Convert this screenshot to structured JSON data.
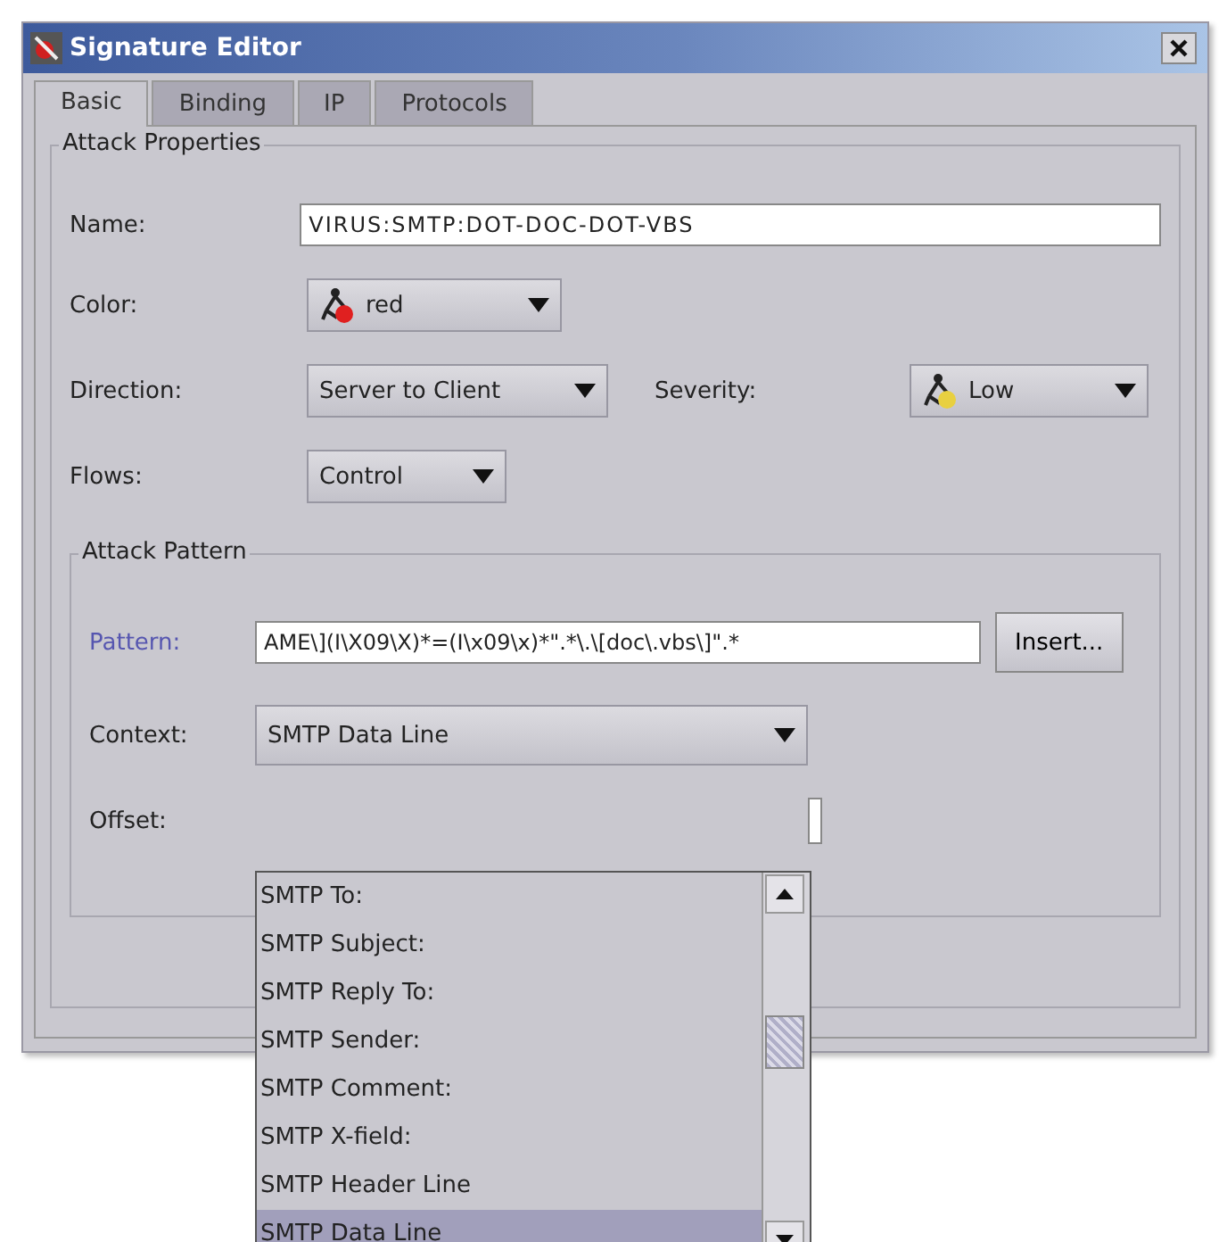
{
  "window": {
    "title": "Signature Editor"
  },
  "tabs": [
    {
      "label": "Basic",
      "selected": true
    },
    {
      "label": "Binding",
      "selected": false
    },
    {
      "label": "IP",
      "selected": false
    },
    {
      "label": "Protocols",
      "selected": false
    }
  ],
  "attack_properties": {
    "title": "Attack Properties",
    "name": {
      "label": "Name:",
      "value": "VIRUS:SMTP:DOT-DOC-DOT-VBS"
    },
    "color": {
      "label": "Color:",
      "value": "red",
      "color": "#e02020"
    },
    "direction": {
      "label": "Direction:",
      "value": "Server to Client"
    },
    "severity": {
      "label": "Severity:",
      "value": "Low",
      "color": "#e8d040"
    },
    "flows": {
      "label": "Flows:",
      "value": "Control"
    }
  },
  "attack_pattern": {
    "title": "Attack Pattern",
    "pattern": {
      "label": "Pattern:",
      "value": "AME\\](I\\X09\\X)*=(I\\x09\\x)*\".*\\.\\[doc\\.vbs\\]\".*"
    },
    "insert_button": "Insert...",
    "context": {
      "label": "Context:",
      "value": "SMTP Data Line"
    },
    "offset": {
      "label": "Offset:"
    }
  },
  "context_list": [
    {
      "label": "SMTP To:",
      "selected": false
    },
    {
      "label": "SMTP Subject:",
      "selected": false
    },
    {
      "label": "SMTP Reply To:",
      "selected": false
    },
    {
      "label": "SMTP Sender:",
      "selected": false
    },
    {
      "label": "SMTP Comment:",
      "selected": false
    },
    {
      "label": "SMTP X-field:",
      "selected": false
    },
    {
      "label": "SMTP Header Line",
      "selected": false
    },
    {
      "label": "SMTP Data Line",
      "selected": true
    }
  ]
}
